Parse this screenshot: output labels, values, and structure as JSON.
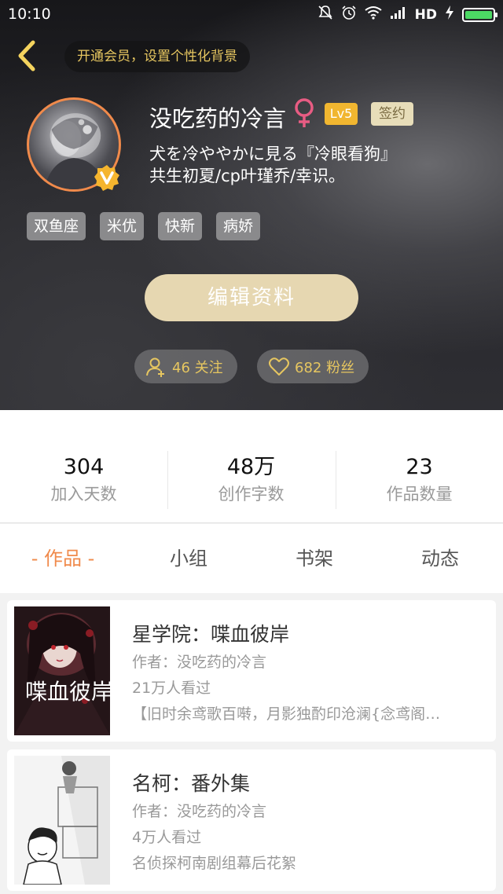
{
  "status_bar": {
    "time": "10:10",
    "network_label": "HD",
    "icons": [
      "mute-icon",
      "alarm-icon",
      "wifi-icon",
      "signal-icon",
      "charging-icon",
      "battery-icon"
    ]
  },
  "header": {
    "vip_prompt": "开通会员，设置个性化背景"
  },
  "profile": {
    "username": "没吃药的冷言",
    "gender_symbol": "♀",
    "level": "Lv5",
    "sign_badge": "签约",
    "bio_line1": "犬を冷ややかに見る『冷眼看狗』",
    "bio_line2": "共生初夏/cp叶瑾乔/幸识。",
    "tags": [
      "双鱼座",
      "米优",
      "快新",
      "病娇"
    ],
    "edit_button": "编辑资料",
    "following": "46 关注",
    "fans": "682 粉丝"
  },
  "stats": [
    {
      "value": "304",
      "label": "加入天数"
    },
    {
      "value": "48万",
      "label": "创作字数"
    },
    {
      "value": "23",
      "label": "作品数量"
    }
  ],
  "tabs": [
    "- 作品 -",
    "小组",
    "书架",
    "动态"
  ],
  "works": [
    {
      "title": "星学院：喋血彼岸",
      "author": "作者：没吃药的冷言",
      "views": "21万人看过",
      "description": "【旧时余鸢歌百啭，月影独酌印沧澜{念鸢阁…",
      "cover_text": "喋血彼岸"
    },
    {
      "title": "名柯：番外集",
      "author": "作者：没吃药的冷言",
      "views": "4万人看过",
      "description": "名侦探柯南剧组幕后花絮"
    }
  ],
  "colors": {
    "accent": "#f08a4b",
    "gold": "#e6c660",
    "edit_button_bg": "#e6d7b1",
    "level_badge": "#f1b630"
  }
}
